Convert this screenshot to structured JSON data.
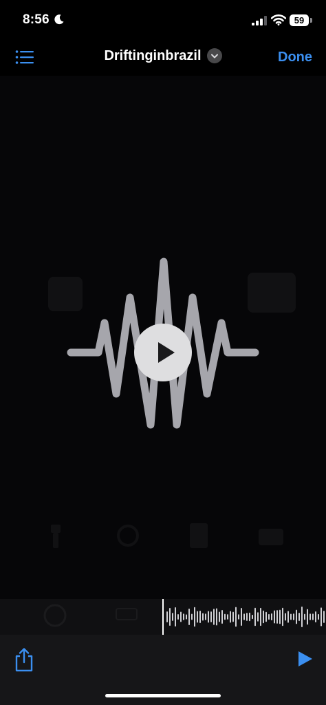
{
  "status": {
    "time": "8:56",
    "battery": "59",
    "icons": [
      "moon-icon",
      "cellular-signal-icon",
      "wifi-icon",
      "battery-icon"
    ]
  },
  "nav": {
    "title": "Driftinginbrazil",
    "done_label": "Done",
    "icons": [
      "list-icon",
      "chevron-down-icon"
    ]
  },
  "preview": {
    "icons": [
      "waveform-icon",
      "play-icon"
    ]
  },
  "scrubber": {
    "icons": [
      "playhead-cursor",
      "audio-waveform"
    ]
  },
  "toolbar": {
    "icons": [
      "share-icon",
      "play-icon"
    ]
  },
  "colors": {
    "accent": "#3b8ff0",
    "background": "#000000",
    "toolbar": "#161618"
  }
}
